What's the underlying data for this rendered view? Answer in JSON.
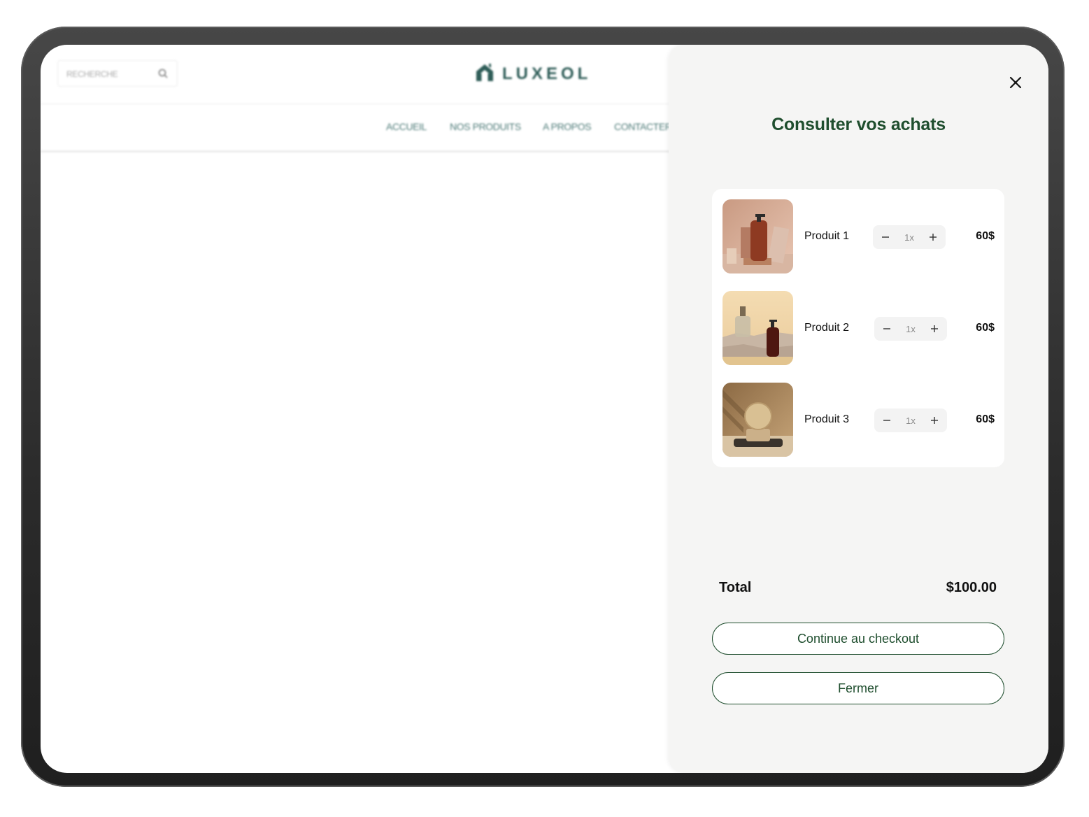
{
  "site": {
    "search_placeholder": "RECHERCHE",
    "logo_text": "LUXEOL",
    "nav": [
      "ACCUEIL",
      "NOS PRODUITS",
      "A PROPOS",
      "CONTACTER"
    ]
  },
  "cart": {
    "title": "Consulter vos achats",
    "items": [
      {
        "name": "Produit 1",
        "qty": "1x",
        "price": "60$"
      },
      {
        "name": "Produit 2",
        "qty": "1x",
        "price": "60$"
      },
      {
        "name": "Produit 3",
        "qty": "1x",
        "price": "60$"
      }
    ],
    "total_label": "Total",
    "total_value": "$100.00",
    "checkout_label": "Continue au checkout",
    "close_label": "Fermer"
  },
  "icons": {
    "close": "close-icon",
    "search": "search-icon",
    "minus": "minus-icon",
    "plus": "plus-icon",
    "logo": "house-logo-icon"
  },
  "colors": {
    "brand_green": "#1f4e2e",
    "logo_teal": "#2f5d58",
    "drawer_bg": "#f5f5f4"
  }
}
